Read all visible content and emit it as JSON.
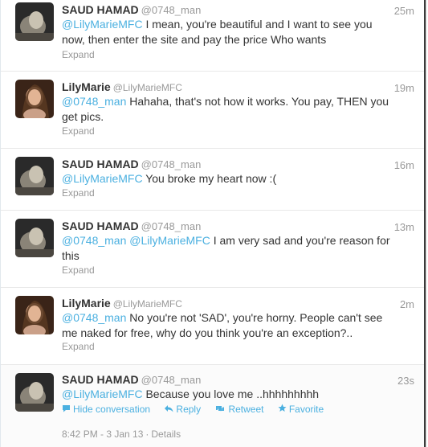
{
  "tweets": [
    {
      "fullname": "SAUD HAMAD",
      "username": "@0748_man",
      "time": "25m",
      "mentions": [
        "@LilyMarieMFC"
      ],
      "text_line1": " I mean, you're beautiful and I want to see you",
      "text_line2": "now, then enter the site and pay the price Who wants",
      "expand": "Expand"
    },
    {
      "fullname": "LilyMarie",
      "username": "@LilyMarieMFC",
      "time": "19m",
      "mentions": [
        "@0748_man"
      ],
      "text_line1": " Hahaha, that's not how it works. You pay, THEN you",
      "text_line2": "get pics.",
      "expand": "Expand"
    },
    {
      "fullname": "SAUD HAMAD",
      "username": "@0748_man",
      "time": "16m",
      "mentions": [
        "@LilyMarieMFC"
      ],
      "text_line1": " You broke my heart now :(",
      "expand": "Expand"
    },
    {
      "fullname": "SAUD HAMAD",
      "username": "@0748_man",
      "time": "13m",
      "mentions": [
        "@0748_man",
        "@LilyMarieMFC"
      ],
      "text_line1": " I am very sad and you're reason for",
      "text_line2": "this",
      "expand": "Expand"
    },
    {
      "fullname": "LilyMarie",
      "username": "@LilyMarieMFC",
      "time": "2m",
      "mentions": [
        "@0748_man"
      ],
      "text_line1": " No you're not 'SAD', you're horny. People can't see",
      "text_line2": "me naked for free, why do you think you're an exception?..",
      "expand": "Expand"
    },
    {
      "fullname": "SAUD HAMAD",
      "username": "@0748_man",
      "time": "23s",
      "mentions": [
        "@LilyMarieMFC"
      ],
      "text_line1": " Because you love me ..hhhhhhhhh"
    }
  ],
  "actions": {
    "hide_conversation": "Hide conversation",
    "reply": "Reply",
    "retweet": "Retweet",
    "favorite": "Favorite",
    "hide_icon": "speech-bubble-icon",
    "reply_icon": "reply-arrow-icon",
    "retweet_icon": "retweet-icon",
    "favorite_icon": "star-icon"
  },
  "meta": {
    "timestamp": "8:42 PM - 3 Jan 13",
    "separator": "·",
    "details": "Details"
  },
  "colors": {
    "link": "#4bb0e0",
    "fullname": "#333333",
    "muted": "#999999"
  }
}
